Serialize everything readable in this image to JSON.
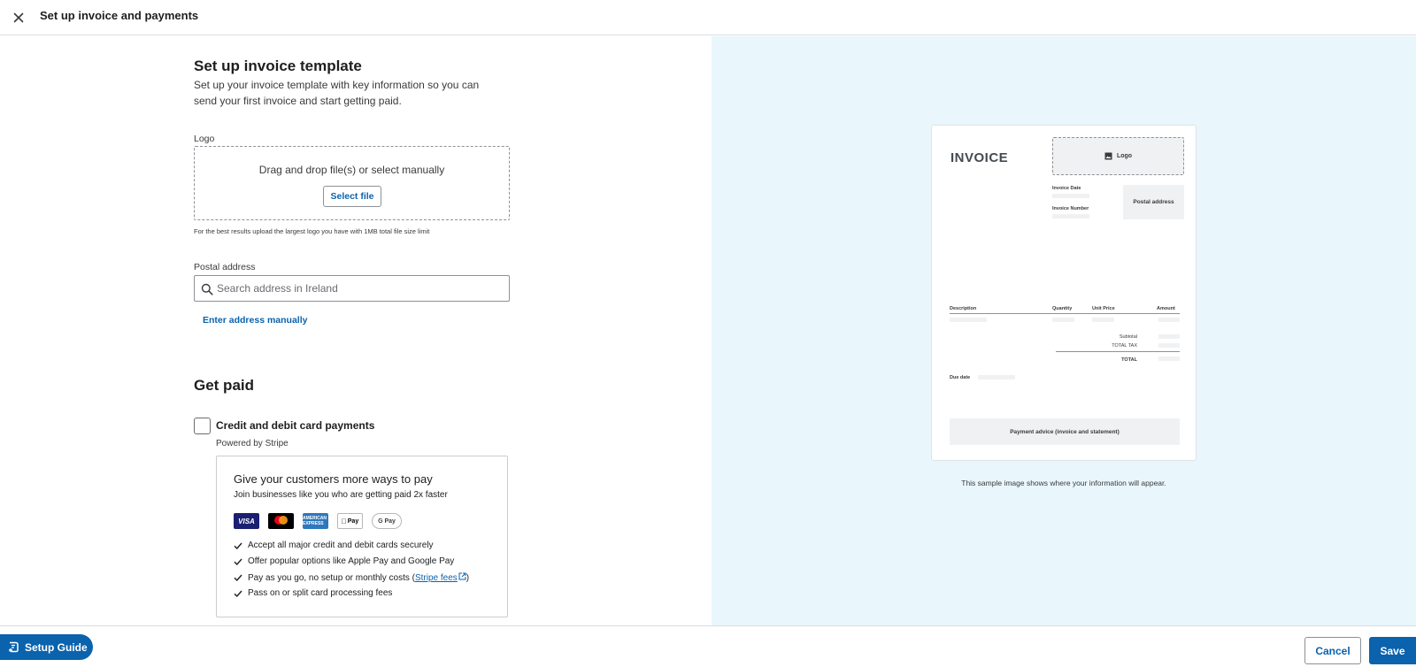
{
  "topbar": {
    "close_icon": "close-icon",
    "title": "Set up invoice and payments"
  },
  "template_section": {
    "title": "Set up invoice template",
    "description": "Set up your invoice template with key information so you can send your first invoice and start getting paid.",
    "logo_label": "Logo",
    "dropzone_text": "Drag and drop file(s) or select manually",
    "select_file_label": "Select file",
    "logo_hint": "For the best results upload the largest logo you have with 1MB total file size limit",
    "postal_label": "Postal address",
    "postal_placeholder": "Search address in Ireland",
    "enter_manually_label": "Enter address manually"
  },
  "get_paid": {
    "title": "Get paid",
    "card_payments_label": "Credit and debit card payments",
    "card_payments_checked": false,
    "powered_by": "Powered by Stripe",
    "promo_title": "Give your customers more ways to pay",
    "promo_subtitle": "Join businesses like you who are getting paid 2x faster",
    "card_brands": {
      "visa": "VISA",
      "amex": "AMERICAN EXPRESS",
      "apple": "Pay",
      "gpay": "G Pay"
    },
    "benefits": [
      "Accept all major credit and debit cards securely",
      "Offer popular options like Apple Pay and Google Pay",
      "Pay as you go, no setup or monthly costs (",
      "Pass on or split card processing fees"
    ],
    "stripe_fees_link": "Stripe fees",
    "benefit_suffix": ")"
  },
  "preview": {
    "invoice_title": "INVOICE",
    "logo_label": "Logo",
    "invoice_date_label": "Invoice Date",
    "invoice_number_label": "Invoice Number",
    "postal_address_label": "Postal address",
    "col_description": "Description",
    "col_quantity": "Quantity",
    "col_unit_price": "Unit Price",
    "col_amount": "Amount",
    "subtotal_label": "Subtotal",
    "total_tax_label": "TOTAL TAX",
    "total_label": "TOTAL",
    "due_date_label": "Due date",
    "payment_advice": "Payment advice (invoice and statement)",
    "caption": "This sample image shows where your information will appear."
  },
  "footer": {
    "setup_guide_label": "Setup Guide",
    "cancel_label": "Cancel",
    "save_label": "Save"
  },
  "colors": {
    "brand_blue": "#0b62ad",
    "preview_bg": "#e9f6fc"
  }
}
